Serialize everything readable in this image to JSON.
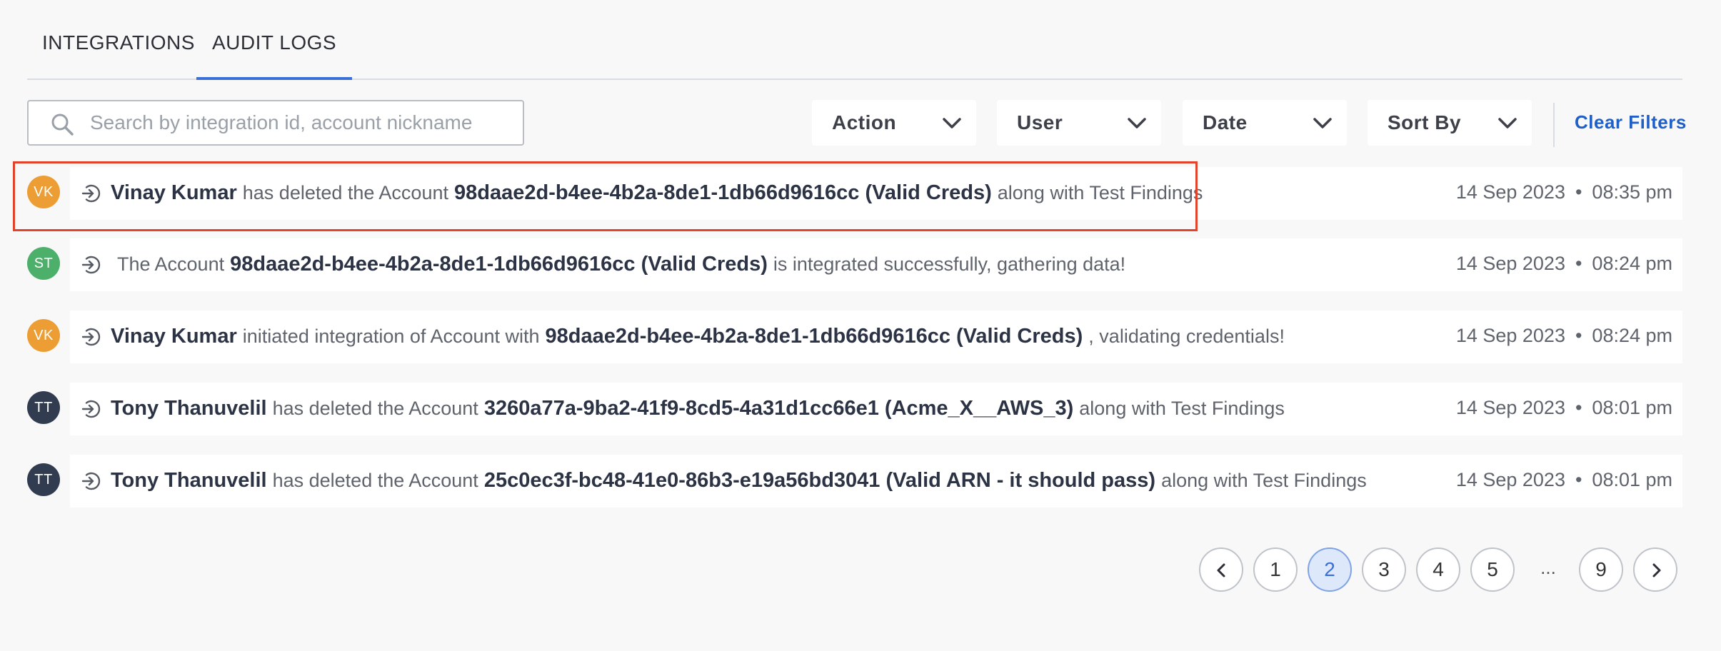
{
  "tabs": [
    {
      "label": "INTEGRATIONS",
      "active": false
    },
    {
      "label": "AUDIT LOGS",
      "active": true
    }
  ],
  "search": {
    "placeholder": "Search by integration id, account nickname",
    "value": ""
  },
  "filters": {
    "action": "Action",
    "user": "User",
    "date": "Date",
    "sort": "Sort By",
    "clear": "Clear Filters"
  },
  "colors": {
    "accent": "#3a6fd8",
    "link": "#1f5fc8",
    "highlight": "#e2442b",
    "avatar_vk": "#ec9e35",
    "avatar_st": "#4caf6a",
    "avatar_tt": "#323c50"
  },
  "logs": [
    {
      "initials": "VK",
      "avatar_color": "#ec9e35",
      "parts": [
        "Vinay Kumar",
        "has deleted the Account",
        "98daae2d-b4ee-4b2a-8de1-1db66d9616cc (Valid Creds)",
        "along with Test Findings"
      ],
      "date": "14 Sep 2023",
      "time": "08:35 pm"
    },
    {
      "initials": "ST",
      "avatar_color": "#4caf6a",
      "parts": [
        "The Account",
        "98daae2d-b4ee-4b2a-8de1-1db66d9616cc (Valid Creds)",
        "is integrated successfully, gathering data!"
      ],
      "date": "14 Sep 2023",
      "time": "08:24 pm"
    },
    {
      "initials": "VK",
      "avatar_color": "#ec9e35",
      "parts": [
        "Vinay Kumar",
        "initiated integration of Account with",
        "98daae2d-b4ee-4b2a-8de1-1db66d9616cc (Valid Creds)",
        ", validating credentials!"
      ],
      "date": "14 Sep 2023",
      "time": "08:24 pm"
    },
    {
      "initials": "TT",
      "avatar_color": "#323c50",
      "parts": [
        "Tony Thanuvelil",
        "has deleted the Account",
        "3260a77a-9ba2-41f9-8cd5-4a31d1cc66e1 (Acme_X__AWS_3)",
        "along with Test Findings"
      ],
      "date": "14 Sep 2023",
      "time": "08:01 pm"
    },
    {
      "initials": "TT",
      "avatar_color": "#323c50",
      "parts": [
        "Tony Thanuvelil",
        "has deleted the Account",
        "25c0ec3f-bc48-41e0-86b3-e19a56bd3041 (Valid ARN - it should pass)",
        "along with Test Findings"
      ],
      "date": "14 Sep 2023",
      "time": "08:01 pm"
    }
  ],
  "pagination": {
    "pages": [
      "1",
      "2",
      "3",
      "4",
      "5"
    ],
    "current": "2",
    "ellipsis": "...",
    "last": "9"
  },
  "icons": {
    "search": "search-icon",
    "chevron": "chevron-down-icon",
    "row": "arrow-in-circle-icon",
    "prev": "chevron-left-icon",
    "next": "chevron-right-icon"
  }
}
